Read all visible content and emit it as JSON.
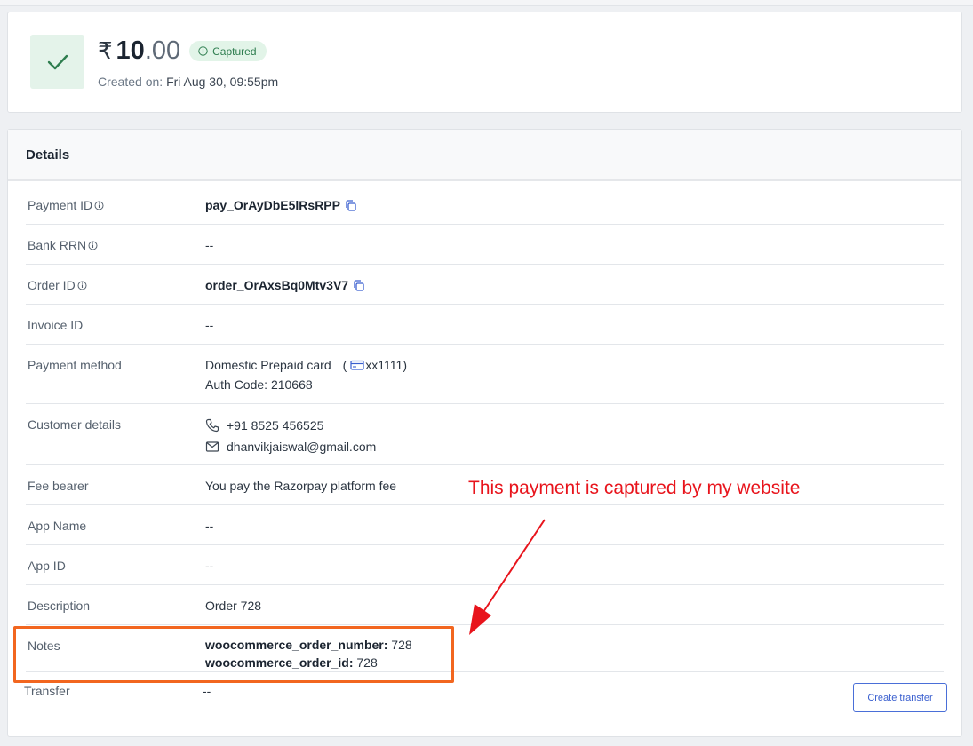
{
  "summary": {
    "currency_symbol": "₹",
    "amount_integer": "10",
    "amount_decimal": ".00",
    "status": "Captured",
    "created_label": "Created on:",
    "created_value": "Fri Aug 30, 09:55pm"
  },
  "details": {
    "title": "Details",
    "payment_id": {
      "label": "Payment ID",
      "value": "pay_OrAyDbE5lRsRPP"
    },
    "bank_rrn": {
      "label": "Bank RRN",
      "value": "--"
    },
    "order_id": {
      "label": "Order ID",
      "value": "order_OrAxsBq0Mtv3V7"
    },
    "invoice_id": {
      "label": "Invoice ID",
      "value": "--"
    },
    "payment_method": {
      "label": "Payment method",
      "type": "Domestic Prepaid card",
      "open_paren": "(",
      "card": "xx1111)",
      "auth_code": "Auth Code: 210668"
    },
    "customer_details": {
      "label": "Customer details",
      "phone": "+91 8525 456525",
      "email": "dhanvikjaiswal@gmail.com"
    },
    "fee_bearer": {
      "label": "Fee bearer",
      "value": "You pay the Razorpay platform fee"
    },
    "app_name": {
      "label": "App Name",
      "value": "--"
    },
    "app_id": {
      "label": "App ID",
      "value": "--"
    },
    "description": {
      "label": "Description",
      "value": "Order 728"
    },
    "notes": {
      "label": "Notes",
      "items": [
        {
          "key": "woocommerce_order_number:",
          "value": "728"
        },
        {
          "key": "woocommerce_order_id:",
          "value": "728"
        }
      ]
    },
    "transfer": {
      "label": "Transfer",
      "value": "--",
      "button": "Create transfer"
    }
  },
  "annotation": {
    "text": "This payment is captured by my website",
    "color": "#e8141c",
    "box_color": "#f2661f"
  }
}
